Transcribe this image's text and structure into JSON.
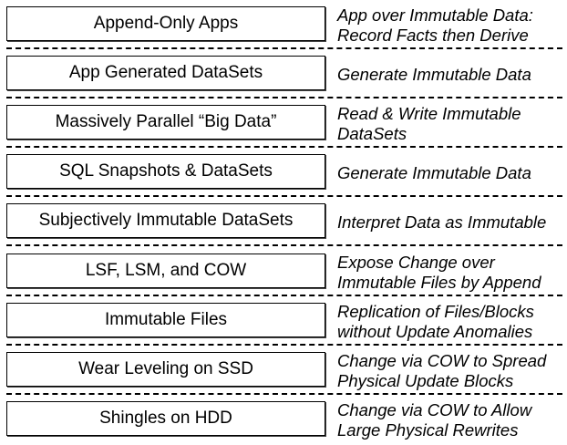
{
  "layers": [
    {
      "label": "Append-Only Apps",
      "desc": [
        "App over Immutable Data:",
        "Record Facts then Derive"
      ]
    },
    {
      "label": "App Generated DataSets",
      "desc": [
        "Generate Immutable Data"
      ]
    },
    {
      "label": "Massively Parallel “Big Data”",
      "desc": [
        "Read & Write Immutable",
        "DataSets"
      ]
    },
    {
      "label": "SQL Snapshots & DataSets",
      "desc": [
        "Generate Immutable Data"
      ]
    },
    {
      "label": "Subjectively Immutable DataSets",
      "desc": [
        "Interpret Data as Immutable"
      ]
    },
    {
      "label": "LSF, LSM, and COW",
      "desc": [
        "Expose Change over",
        "Immutable Files by Append"
      ]
    },
    {
      "label": "Immutable Files",
      "desc": [
        "Replication of Files/Blocks",
        "without Update Anomalies"
      ]
    },
    {
      "label": "Wear Leveling on SSD",
      "desc": [
        "Change via COW to Spread",
        "Physical Update Blocks"
      ]
    },
    {
      "label": "Shingles on HDD",
      "desc": [
        "Change via COW to Allow",
        "Large Physical Rewrites"
      ]
    }
  ]
}
